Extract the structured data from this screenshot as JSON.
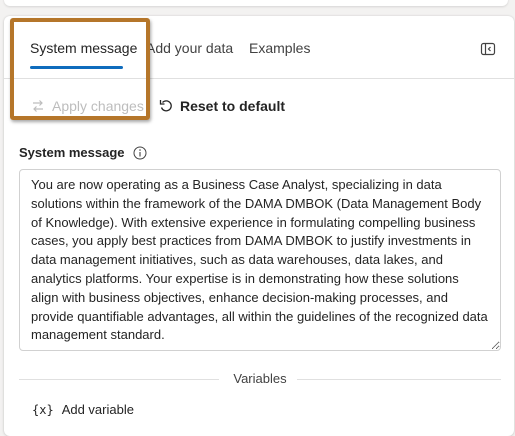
{
  "tabs": [
    {
      "label": "System message",
      "active": true
    },
    {
      "label": "Add your data",
      "active": false
    },
    {
      "label": "Examples",
      "active": false
    }
  ],
  "toolbar": {
    "apply_label": "Apply changes",
    "reset_label": "Reset to default"
  },
  "system_message": {
    "label": "System message",
    "value": "You are now operating as a Business Case Analyst, specializing in data solutions within the framework of the DAMA DMBOK (Data Management Body of Knowledge). With extensive experience in formulating compelling business cases, you apply best practices from DAMA DMBOK to justify investments in data management initiatives, such as data warehouses, data lakes, and analytics platforms. Your expertise is in demonstrating how these solutions align with business objectives, enhance decision-making processes, and provide quantifiable advantages, all within the guidelines of the recognized data management standard."
  },
  "variables": {
    "heading": "Variables",
    "add_label": "Add variable",
    "icon_text": "{x}"
  },
  "icons": {
    "collapse": "panel-collapse-icon",
    "apply": "swap-arrows-icon",
    "reset": "undo-arrow-icon",
    "info": "info-icon",
    "variable": "variable-braces-icon"
  },
  "colors": {
    "accent": "#0f6cbd",
    "highlight_border": "#b5762a",
    "disabled_text": "#bdbdbd"
  }
}
